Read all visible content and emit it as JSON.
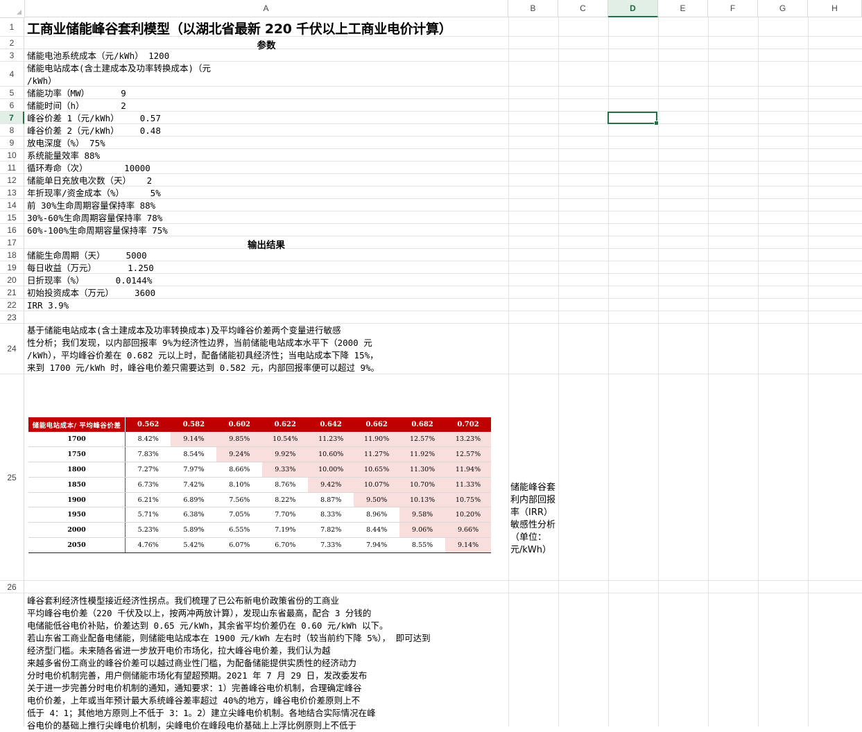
{
  "columns": [
    "A",
    "B",
    "C",
    "D",
    "E",
    "F",
    "G",
    "H"
  ],
  "rows": [
    "1",
    "2",
    "3",
    "4",
    "5",
    "6",
    "7",
    "8",
    "9",
    "10",
    "11",
    "12",
    "13",
    "14",
    "15",
    "16",
    "17",
    "18",
    "19",
    "20",
    "21",
    "22",
    "23",
    "24",
    "25",
    "26"
  ],
  "title": "工商业储能峰谷套利模型（以湖北省最新 220 千伏以上工商业电价计算）",
  "params_header": "参数",
  "params": [
    "储能电池系统成本（元/kWh） 1200",
    "储能电站成本(含土建成本及功率转换成本)（元",
    "/kWh）",
    "储能功率（MW）      9",
    "储能时间（h）       2",
    "峰谷价差 1（元/kWh）    0.57",
    "峰谷价差 2（元/kWh）    0.48",
    "放电深度（%） 75%",
    "系统能量效率 88%",
    "循环寿命（次）       10000",
    "储能单日充放电次数（天）   2",
    "年折现率/资金成本（%）     5%",
    "前 30%生命周期容量保持率 88%",
    "30%-60%生命周期容量保持率 78%",
    "60%-100%生命周期容量保持率 75%"
  ],
  "output_header": "输出结果",
  "outputs": [
    "储能生命周期（天）    5000",
    "每日收益（万元）      1.250",
    "日折现率（%）      0.0144%",
    "初始投资成本（万元）    3600",
    "IRR 3.9%"
  ],
  "row24_text": "基于储能电站成本(含土建成本及功率转换成本)及平均峰谷价差两个变量进行敏感\n性分析；我们发现，以内部回报率 9%为经济性边界，当前储能电站成本水平下（2000 元\n/kWh），平均峰谷价差在 0.682 元以上时，配备储能初具经济性；当电站成本下降 15%，\n来到 1700 元/kWh 时，峰谷电价差只需要达到 0.582 元，内部回报率便可以超过 9%。",
  "sensitivity_table": {
    "corner_label": "储能电站成本/ 平均峰谷价差",
    "headers": [
      "0.562",
      "0.582",
      "0.602",
      "0.622",
      "0.642",
      "0.662",
      "0.682",
      "0.702"
    ],
    "rows": [
      {
        "label": "1700",
        "values": [
          "8.42%",
          "9.14%",
          "9.85%",
          "10.54%",
          "11.23%",
          "11.90%",
          "12.57%",
          "13.23%"
        ],
        "first_pink": 1
      },
      {
        "label": "1750",
        "values": [
          "7.83%",
          "8.54%",
          "9.24%",
          "9.92%",
          "10.60%",
          "11.27%",
          "11.92%",
          "12.57%"
        ],
        "first_pink": 2
      },
      {
        "label": "1800",
        "values": [
          "7.27%",
          "7.97%",
          "8.66%",
          "9.33%",
          "10.00%",
          "10.65%",
          "11.30%",
          "11.94%"
        ],
        "first_pink": 3
      },
      {
        "label": "1850",
        "values": [
          "6.73%",
          "7.42%",
          "8.10%",
          "8.76%",
          "9.42%",
          "10.07%",
          "10.70%",
          "11.33%"
        ],
        "first_pink": 4
      },
      {
        "label": "1900",
        "values": [
          "6.21%",
          "6.89%",
          "7.56%",
          "8.22%",
          "8.87%",
          "9.50%",
          "10.13%",
          "10.75%"
        ],
        "first_pink": 5
      },
      {
        "label": "1950",
        "values": [
          "5.71%",
          "6.38%",
          "7.05%",
          "7.70%",
          "8.33%",
          "8.96%",
          "9.58%",
          "10.20%"
        ],
        "first_pink": 6
      },
      {
        "label": "2000",
        "values": [
          "5.23%",
          "5.89%",
          "6.55%",
          "7.19%",
          "7.82%",
          "8.44%",
          "9.06%",
          "9.66%"
        ],
        "first_pink": 6
      },
      {
        "label": "2050",
        "values": [
          "4.76%",
          "5.42%",
          "6.07%",
          "6.70%",
          "7.33%",
          "7.94%",
          "8.55%",
          "9.14%"
        ],
        "first_pink": 7
      }
    ]
  },
  "side_label": "储能峰谷套利内部回报率（IRR）敏感性分析（单位：元/kWh）",
  "bottom_text": "峰谷套利经济性模型接近经济性拐点。我们梳理了已公布新电价政策省份的工商业\n平均峰谷电价差（220 千伏及以上，按两冲两放计算），发现山东省最高，配合 3 分钱的\n电储能低谷电价补贴，价差达到 0.65 元/kWh，其余省平均价差仍在 0.60 元/kWh 以下。\n若山东省工商业配备电储能，则储能电站成本在 1900 元/kWh 左右时（较当前约下降 5%）， 即可达到\n经济型门槛。未来随各省进一步放开电价市场化，拉大峰谷电价差，我们认为越\n来越多省份工商业的峰谷价差可以越过商业性门槛，为配备储能提供实质性的经济动力\n分时电价机制完善，用户侧储能市场化有望超预期。2021 年 7 月 29 日，发改委发布\n关于进一步完善分时电价机制的通知，通知要求：1）完善峰谷电价机制，合理确定峰谷\n电价价差，上年或当年预计最大系统峰谷差率超过 40%的地方，峰谷电价价差原则上不\n低于 4：1；其他地方原则上不低于 3：1。2）建立尖峰电价机制。各地结合实际情况在峰\n谷电价的基础上推行尖峰电价机制，尖峰电价在峰段电价基础上上浮比例原则上不低于",
  "selected_column": "D",
  "selected_row": "7"
}
